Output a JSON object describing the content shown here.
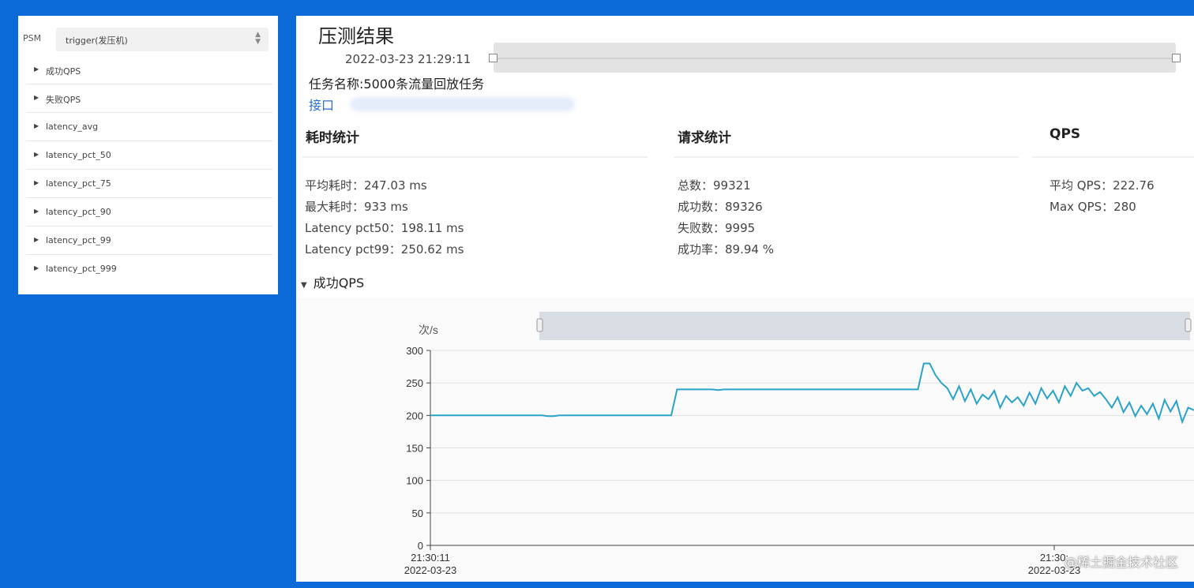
{
  "sidebar": {
    "psm_label": "PSM",
    "psm_value": "trigger(发压机)",
    "items": [
      {
        "label": "成功QPS"
      },
      {
        "label": "失败QPS"
      },
      {
        "label": "latency_avg"
      },
      {
        "label": "latency_pct_50"
      },
      {
        "label": "latency_pct_75"
      },
      {
        "label": "latency_pct_90"
      },
      {
        "label": "latency_pct_99"
      },
      {
        "label": "latency_pct_999"
      }
    ]
  },
  "header": {
    "title": "压测结果",
    "datetime": "2022-03-23 21:29:11",
    "task_name": "任务名称:5000条流量回放任务",
    "api_label": "接口"
  },
  "stats": {
    "latency": {
      "title": "耗时统计",
      "lines": [
        "平均耗时：247.03 ms",
        "最大耗时：933 ms",
        "Latency pct50：198.11 ms",
        "Latency pct99：250.62 ms"
      ]
    },
    "requests": {
      "title": "请求统计",
      "lines": [
        "总数：99321",
        "成功数：89326",
        "失败数：9995",
        "成功率：89.94 %"
      ]
    },
    "qps": {
      "title": "QPS",
      "lines": [
        "平均 QPS：222.76",
        "Max QPS：280"
      ]
    }
  },
  "chart_section": {
    "toggle_label": "成功QPS"
  },
  "chart_data": {
    "type": "line",
    "ylabel": "次/s",
    "ylim": [
      0,
      300
    ],
    "yticks": [
      0,
      50,
      100,
      150,
      200,
      250,
      300
    ],
    "x_tick_labels": [
      {
        "time": "21:30:11",
        "date": "2022-03-23"
      },
      {
        "time": "21:30:",
        "date": "2022-03-23"
      }
    ],
    "series": [
      {
        "color": "#2aa3c9",
        "values": [
          200,
          200,
          200,
          200,
          200,
          200,
          200,
          200,
          200,
          200,
          200,
          200,
          200,
          200,
          200,
          200,
          200,
          200,
          200,
          200,
          199,
          199,
          200,
          200,
          200,
          200,
          200,
          200,
          200,
          200,
          200,
          200,
          200,
          200,
          200,
          200,
          200,
          200,
          200,
          200,
          200,
          200,
          240,
          240,
          240,
          240,
          240,
          240,
          240,
          239,
          240,
          240,
          240,
          240,
          240,
          240,
          240,
          240,
          240,
          240,
          240,
          240,
          240,
          240,
          240,
          240,
          240,
          240,
          240,
          240,
          240,
          240,
          240,
          240,
          240,
          240,
          240,
          240,
          240,
          240,
          240,
          240,
          240,
          240,
          280,
          280,
          262,
          250,
          242,
          225,
          245,
          222,
          240,
          218,
          232,
          225,
          238,
          212,
          230,
          220,
          228,
          215,
          235,
          218,
          242,
          226,
          238,
          220,
          245,
          230,
          250,
          238,
          242,
          230,
          236,
          225,
          212,
          228,
          205,
          220,
          199,
          215,
          202,
          218,
          195,
          224,
          206,
          222,
          190,
          212,
          208
        ]
      }
    ],
    "grid": true
  },
  "footer": {
    "watermark": "@稀土掘金技术社区"
  }
}
